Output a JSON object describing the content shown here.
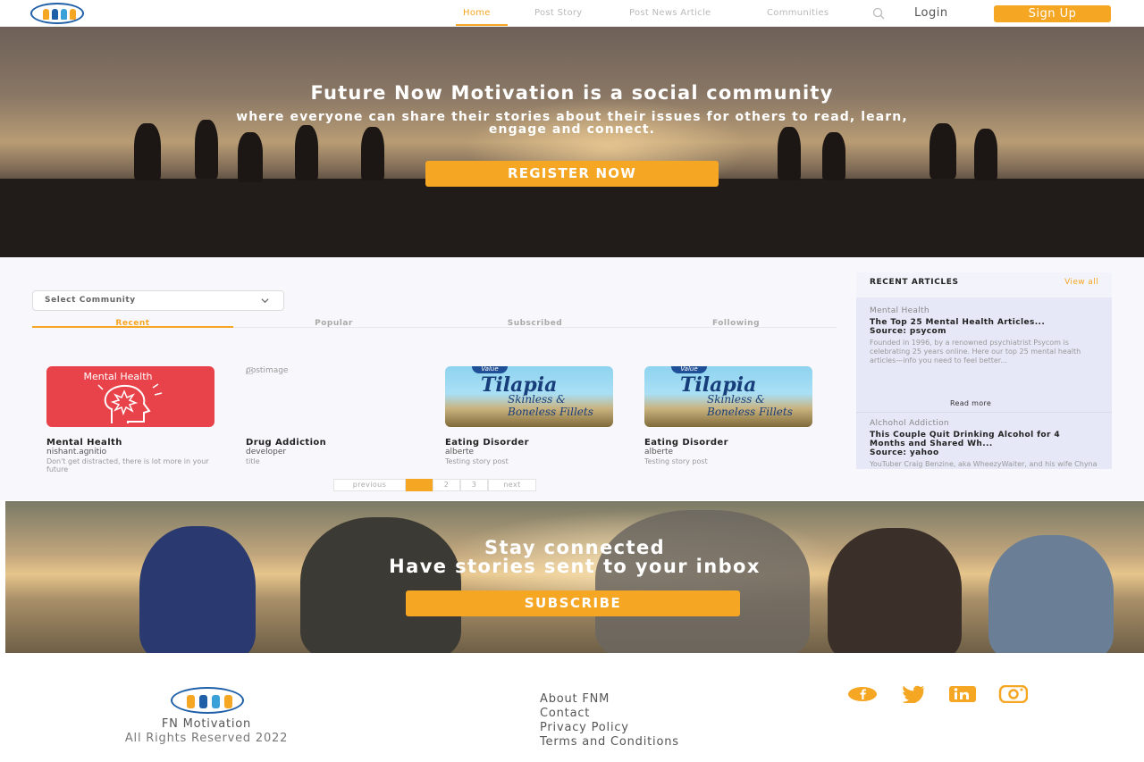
{
  "nav": {
    "links": [
      "Home",
      "Post Story",
      "Post News Article",
      "Communities"
    ],
    "login": "Login",
    "signup": "Sign Up"
  },
  "hero": {
    "title": "Future Now Motivation is a social community",
    "subtitle_line1": "where everyone can share their stories about their issues for others to read, learn,",
    "subtitle_line2": "engage and connect.",
    "cta": "REGISTER NOW"
  },
  "filter": {
    "select_placeholder": "Select Community",
    "tabs": [
      "Recent",
      "Popular",
      "Subscribed",
      "Following"
    ]
  },
  "cards": [
    {
      "title": "Mental Health",
      "author": "nishant.agnitio",
      "snippet": "Don't get distracted, there is lot more in your future",
      "image_label": "Mental Health"
    },
    {
      "title": "Drug Addiction",
      "author": "developer",
      "snippet": "title",
      "image_alt": "postimage"
    },
    {
      "title": "Eating Disorder",
      "author": "alberte",
      "snippet": "Testing story post",
      "image_brand": "Tilapia",
      "image_sub": "Skinless & Boneless Fillets",
      "image_tag": "Value"
    },
    {
      "title": "Eating Disorder",
      "author": "alberte",
      "snippet": "Testing story post",
      "image_brand": "Tilapia",
      "image_sub": "Skinless & Boneless Fillets",
      "image_tag": "Value"
    }
  ],
  "pagination": {
    "previous": "previous",
    "pages": [
      "1",
      "2",
      "3"
    ],
    "next": "next",
    "current": "1"
  },
  "recent_articles": {
    "title": "RECENT ARTICLES",
    "view_all": "View all",
    "items": [
      {
        "category": "Mental Health",
        "title": "The Top 25 Mental Health Articles...",
        "source": "Source: psycom",
        "description": "Founded in 1996, by a renowned psychiatrist Psycom is celebrating 25 years online. Here our top 25 mental health articles—info you need to feel better...",
        "read_more": "Read more"
      },
      {
        "category": "Alchohol Addiction",
        "title": "This Couple Quit Drinking Alcohol for 4 Months and Shared Wh...",
        "source": "Source: yahoo",
        "description": "YouTuber Craig Benzine, aka WheezyWaiter, and his wife Chyna"
      }
    ]
  },
  "subscribe": {
    "line1": "Stay connected",
    "line2": "Have stories sent to your inbox",
    "cta": "SUBSCRIBE"
  },
  "footer": {
    "name": "FN Motivation",
    "rights": "All Rights Reserved 2022",
    "links": [
      "About FNM",
      "Contact",
      "Privacy Policy",
      "Terms and Conditions"
    ],
    "social": [
      "facebook-icon",
      "twitter-icon",
      "linkedin-icon",
      "instagram-icon"
    ]
  },
  "colors": {
    "accent": "#f5a623",
    "brand_blue": "#1f5fa8",
    "card_red": "#e8434a"
  }
}
